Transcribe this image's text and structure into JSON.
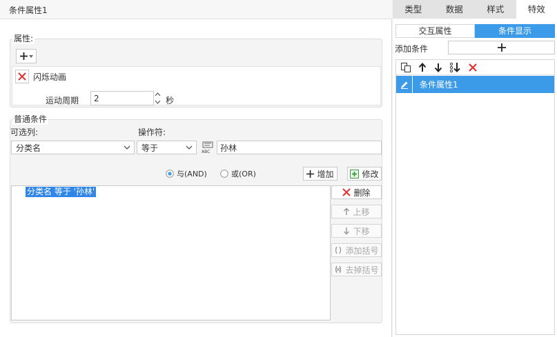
{
  "panel_title": "条件属性1",
  "right_tabs": [
    "类型",
    "数据",
    "样式",
    "特效"
  ],
  "property_section": {
    "label": "属性:",
    "attr_name": "闪烁动画",
    "period_label": "运动周期",
    "period_value": "2",
    "period_unit": "秒"
  },
  "conditions": {
    "label": "普通条件",
    "column_label": "可选列:",
    "column_value": "分类名",
    "operator_label": "操作符:",
    "operator_value": "等于",
    "value": "孙林",
    "and_label": "与(AND)",
    "or_label": "或(OR)",
    "and_selected": true,
    "add_label": "增加",
    "modify_label": "修改",
    "list": [
      "分类名 等于 '孙林'"
    ],
    "side_buttons": {
      "delete": "删除",
      "up": "上移",
      "down": "下移",
      "add_bracket": "添加括号",
      "remove_bracket": "去掉括号"
    }
  },
  "right_panel": {
    "sub_tabs": [
      "交互属性",
      "条件显示"
    ],
    "add_condition_label": "添加条件",
    "items": [
      "条件属性1"
    ]
  },
  "colors": {
    "accent": "#3c9be8",
    "selection": "#2f86e8",
    "delete_red": "#e03131",
    "add_green": "#3a9a3a"
  }
}
